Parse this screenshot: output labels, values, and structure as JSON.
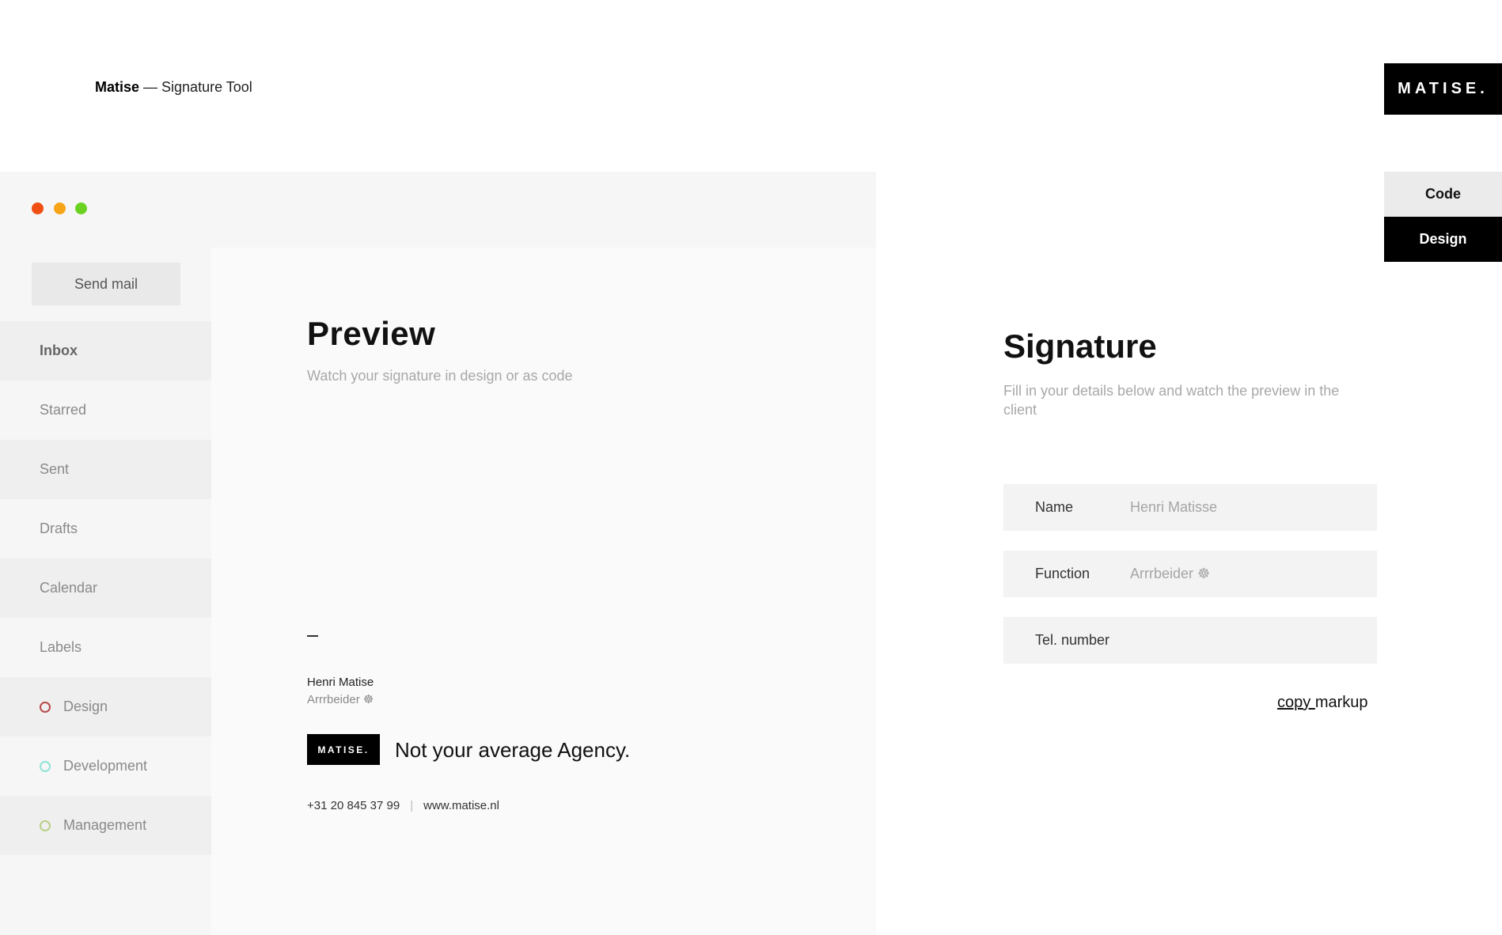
{
  "header": {
    "brand": "Matise",
    "title_suffix": " — Signature Tool",
    "logo_text": "MATISE."
  },
  "view_toggle": {
    "code_label": "Code",
    "design_label": "Design",
    "active": "Design"
  },
  "window": {
    "traffic_lights": [
      "#f04e12",
      "#f7a418",
      "#6bd221"
    ]
  },
  "sidebar": {
    "send_mail_label": "Send mail",
    "items": [
      {
        "label": "Inbox"
      },
      {
        "label": "Starred"
      },
      {
        "label": "Sent"
      },
      {
        "label": "Drafts"
      },
      {
        "label": "Calendar"
      },
      {
        "label": "Labels"
      },
      {
        "label": "Design",
        "dot_color": "#b94b4b"
      },
      {
        "label": "Development",
        "dot_color": "#8fe3d6"
      },
      {
        "label": "Management",
        "dot_color": "#b9cf86"
      }
    ]
  },
  "preview": {
    "title": "Preview",
    "subtitle": "Watch your signature in design or as code",
    "signature": {
      "dash": "—",
      "name": "Henri Matise",
      "function": "Arrrbeider ☸",
      "logo_text": "MATISE.",
      "tagline": "Not your average Agency.",
      "phone": "+31 20 845 37 99",
      "separator": "|",
      "website": "www.matise.nl"
    }
  },
  "form": {
    "title": "Signature",
    "description": "Fill in your details below and watch the preview in the client",
    "fields": [
      {
        "label": "Name",
        "placeholder": "Henri Matisse",
        "value": ""
      },
      {
        "label": "Function",
        "placeholder": "Arrrbeider ☸",
        "value": ""
      },
      {
        "label": "Tel. number",
        "placeholder": "",
        "value": ""
      }
    ],
    "copy_link": "copy ",
    "copy_text": "markup"
  }
}
